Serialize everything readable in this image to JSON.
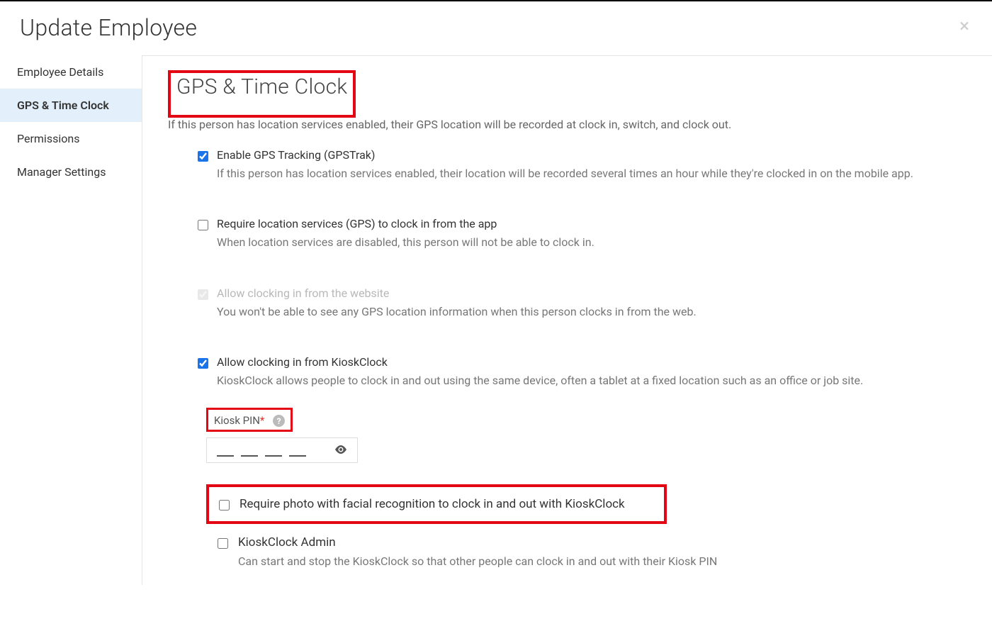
{
  "header": {
    "title": "Update Employee"
  },
  "sidebar": {
    "items": [
      {
        "label": "Employee Details"
      },
      {
        "label": "GPS & Time Clock"
      },
      {
        "label": "Permissions"
      },
      {
        "label": "Manager Settings"
      }
    ]
  },
  "main": {
    "section_title": "GPS & Time Clock",
    "section_desc": "If this person has location services enabled, their GPS location will be recorded at clock in, switch, and clock out.",
    "options": {
      "gps_track": {
        "label": "Enable GPS Tracking (GPSTrak)",
        "desc": "If this person has location services enabled, their location will be recorded several times an hour while they're clocked in on the mobile app."
      },
      "require_gps": {
        "label": "Require location services (GPS) to clock in from the app",
        "desc": "When location services are disabled, this person will not be able to clock in."
      },
      "allow_web": {
        "label": "Allow clocking in from the website",
        "desc": "You won't be able to see any GPS location information when this person clocks in from the web."
      },
      "allow_kiosk": {
        "label": "Allow clocking in from KioskClock",
        "desc": "KioskClock allows people to clock in and out using the same device, often a tablet at a fixed location such as an office or job site."
      },
      "kiosk_pin": {
        "label": "Kiosk PIN"
      },
      "require_photo": {
        "label": "Require photo with facial recognition to clock in and out with KioskClock"
      },
      "kiosk_admin": {
        "label": "KioskClock Admin",
        "desc": "Can start and stop the KioskClock so that other people can clock in and out with their Kiosk PIN"
      }
    }
  }
}
